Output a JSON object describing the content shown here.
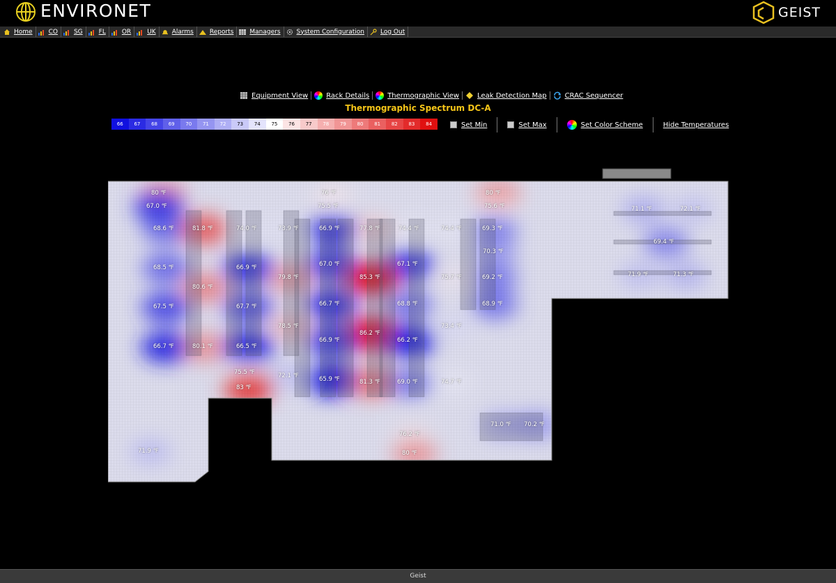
{
  "header": {
    "brand": "ENVIRONET",
    "vendor": "GEIST"
  },
  "nav": [
    {
      "label": "Home",
      "icon": "home-icon"
    },
    {
      "label": "CO",
      "icon": "signal-bars-icon"
    },
    {
      "label": "SG",
      "icon": "signal-bars-icon"
    },
    {
      "label": "FL",
      "icon": "signal-bars-icon"
    },
    {
      "label": "OR",
      "icon": "signal-bars-icon"
    },
    {
      "label": "UK",
      "icon": "signal-bars-icon"
    },
    {
      "label": "Alarms",
      "icon": "bell-icon"
    },
    {
      "label": "Reports",
      "icon": "chart-icon"
    },
    {
      "label": "Managers",
      "icon": "grid-icon"
    },
    {
      "label": "System Configuration",
      "icon": "gear-icon"
    },
    {
      "label": "Log Out",
      "icon": "key-icon"
    }
  ],
  "views": [
    {
      "label": "Equipment View",
      "icon": "rack-icon"
    },
    {
      "label": "Rack Details",
      "icon": "color-wheel-icon"
    },
    {
      "label": "Thermographic View",
      "icon": "color-wheel-icon"
    },
    {
      "label": "Leak Detection Map",
      "icon": "diamond-icon"
    },
    {
      "label": "CRAC Sequencer",
      "icon": "refresh-icon"
    }
  ],
  "title": "Thermographic Spectrum DC-A",
  "legend": [
    "66",
    "67",
    "68",
    "69",
    "70",
    "71",
    "72",
    "73",
    "74",
    "75",
    "76",
    "77",
    "78",
    "79",
    "80",
    "81",
    "82",
    "83",
    "84"
  ],
  "controls": {
    "set_min": "Set Min",
    "set_max": "Set Max",
    "set_color_scheme": "Set Color Scheme",
    "hide_temps": "Hide Temperatures"
  },
  "colors": {
    "cold": "#1010e0",
    "neutral": "#ffffff",
    "hot": "#e01010",
    "title": "#f5c518"
  },
  "temperatures": [
    {
      "text": "80 ℉",
      "t": 80
    },
    {
      "text": "76 ℉",
      "t": 76
    },
    {
      "text": "80 ℉",
      "t": 80
    },
    {
      "text": "67.0 ℉",
      "t": 67.0
    },
    {
      "text": "75.5 ℉",
      "t": 75.5
    },
    {
      "text": "75.6 ℉",
      "t": 75.6
    },
    {
      "text": "71.1 ℉",
      "t": 71.1
    },
    {
      "text": "72.1 ℉",
      "t": 72.1
    },
    {
      "text": "68.6 ℉",
      "t": 68.6
    },
    {
      "text": "81.8 ℉",
      "t": 81.8
    },
    {
      "text": "74.0 ℉",
      "t": 74.0
    },
    {
      "text": "73.9 ℉",
      "t": 73.9
    },
    {
      "text": "66.9 ℉",
      "t": 66.9
    },
    {
      "text": "77.8 ℉",
      "t": 77.8
    },
    {
      "text": "74.4 ℉",
      "t": 74.4
    },
    {
      "text": "74.4 ℉",
      "t": 74.4
    },
    {
      "text": "69.3 ℉",
      "t": 69.3
    },
    {
      "text": "69.4 ℉",
      "t": 69.4
    },
    {
      "text": "70.3 ℉",
      "t": 70.3
    },
    {
      "text": "68.5 ℉",
      "t": 68.5
    },
    {
      "text": "66.9 ℉",
      "t": 66.9
    },
    {
      "text": "67.0 ℉",
      "t": 67.0
    },
    {
      "text": "67.1 ℉",
      "t": 67.1
    },
    {
      "text": "79.8 ℉",
      "t": 79.8
    },
    {
      "text": "85.3 ℉",
      "t": 85.3
    },
    {
      "text": "75.7 ℉",
      "t": 75.7
    },
    {
      "text": "69.2 ℉",
      "t": 69.2
    },
    {
      "text": "71.9 ℉",
      "t": 71.9
    },
    {
      "text": "71.3 ℉",
      "t": 71.3
    },
    {
      "text": "80.6 ℉",
      "t": 80.6
    },
    {
      "text": "67.5 ℉",
      "t": 67.5
    },
    {
      "text": "67.7 ℉",
      "t": 67.7
    },
    {
      "text": "66.7 ℉",
      "t": 66.7
    },
    {
      "text": "68.8 ℉",
      "t": 68.8
    },
    {
      "text": "68.9 ℉",
      "t": 68.9
    },
    {
      "text": "78.5 ℉",
      "t": 78.5
    },
    {
      "text": "73.4 ℉",
      "t": 73.4
    },
    {
      "text": "86.2 ℉",
      "t": 86.2
    },
    {
      "text": "66.7 ℉",
      "t": 66.7
    },
    {
      "text": "80.1 ℉",
      "t": 80.1
    },
    {
      "text": "66.5 ℉",
      "t": 66.5
    },
    {
      "text": "66.9 ℉",
      "t": 66.9
    },
    {
      "text": "66.2 ℉",
      "t": 66.2
    },
    {
      "text": "75.5 ℉",
      "t": 75.5
    },
    {
      "text": "72.1 ℉",
      "t": 72.1
    },
    {
      "text": "65.9 ℉",
      "t": 65.9
    },
    {
      "text": "81.3 ℉",
      "t": 81.3
    },
    {
      "text": "69.0 ℉",
      "t": 69.0
    },
    {
      "text": "74.7 ℉",
      "t": 74.7
    },
    {
      "text": "83 ℉",
      "t": 83
    },
    {
      "text": "71.0 ℉",
      "t": 71.0
    },
    {
      "text": "70.2 ℉",
      "t": 70.2
    },
    {
      "text": "76.2 ℉",
      "t": 76.2
    },
    {
      "text": "80 ℉",
      "t": 80
    },
    {
      "text": "71.9 ℉",
      "t": 71.9
    }
  ],
  "footer": "Geist"
}
